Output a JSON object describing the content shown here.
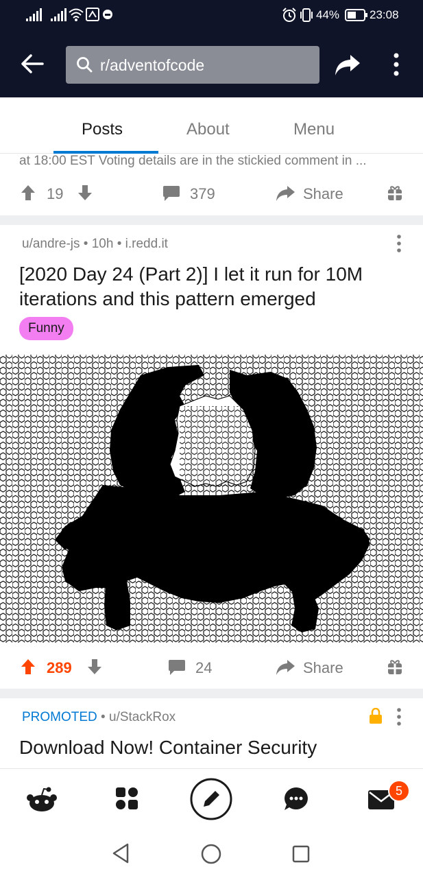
{
  "status_bar": {
    "battery": "44%",
    "time": "23:08"
  },
  "header": {
    "search_text": "r/adventofcode"
  },
  "tabs": [
    {
      "label": "Posts"
    },
    {
      "label": "About"
    },
    {
      "label": "Menu"
    }
  ],
  "post1": {
    "truncated_text": "at 18:00 EST Voting details are in the stickied comment in ...",
    "votes": "19",
    "comments": "379",
    "share_label": "Share"
  },
  "post2": {
    "author": "u/andre-js",
    "age": "10h",
    "domain": "i.redd.it",
    "title": "[2020 Day 24 (Part 2)] I let it run for 10M iterations and this pattern emerged",
    "flair": "Funny",
    "votes": "289",
    "comments": "24",
    "share_label": "Share"
  },
  "post3": {
    "promoted": "PROMOTED",
    "author": "u/StackRox",
    "title": "Download Now! Container Security"
  },
  "bottom_nav": {
    "inbox_badge": "5"
  },
  "colors": {
    "header_bg": "#0f1429",
    "tab_accent": "#0079d3",
    "upvote": "#ff4500",
    "flair": "#f27ef2",
    "promoted": "#0079d3",
    "badge": "#ff4500",
    "lock": "#ffb000"
  }
}
